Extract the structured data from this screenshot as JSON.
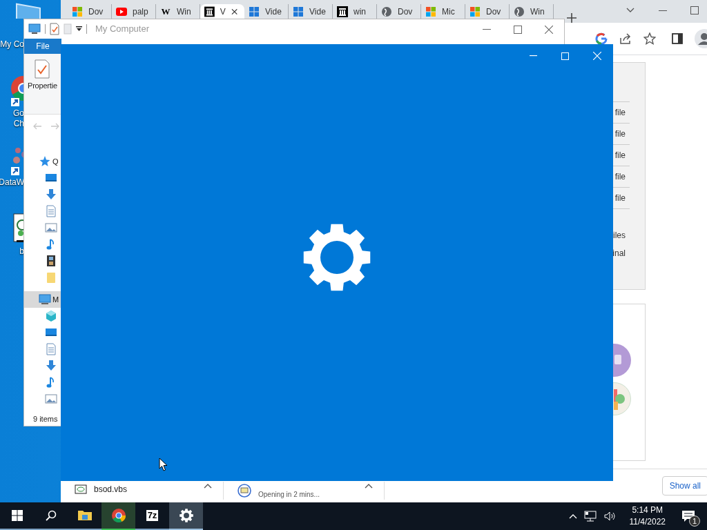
{
  "desktop_icons": [
    {
      "kind": "computer",
      "lines": [
        "My Co"
      ]
    },
    {
      "kind": "chrome",
      "shortcut": true,
      "lines": [
        "Go",
        "Ch"
      ]
    },
    {
      "kind": "data",
      "shortcut": true,
      "lines": [
        "DataW"
      ]
    },
    {
      "kind": "script",
      "shortcut": false,
      "lines": [
        "b"
      ]
    }
  ],
  "browser": {
    "tabs": [
      {
        "kind": "ms",
        "label": "Dov",
        "selected": false
      },
      {
        "kind": "video",
        "label": "palp",
        "selected": false
      },
      {
        "kind": "wiki",
        "favicon_text": "W",
        "label": "Win",
        "selected": false
      },
      {
        "kind": "archive",
        "label": "V",
        "selected": true
      },
      {
        "kind": "win",
        "label": "Vide",
        "selected": false
      },
      {
        "kind": "win",
        "label": "Vide",
        "selected": false
      },
      {
        "kind": "archive",
        "label": "win",
        "selected": false
      },
      {
        "kind": "globe",
        "label": "Dov",
        "selected": false
      },
      {
        "kind": "ms",
        "label": "Mic",
        "selected": false
      },
      {
        "kind": "ms",
        "label": "Dov",
        "selected": false
      },
      {
        "kind": "globe",
        "label": "Win",
        "selected": false
      }
    ],
    "card_sections": [
      {
        "kind": "list",
        "rows": [
          "file",
          "file",
          "file",
          "file",
          "file"
        ]
      },
      {
        "kind": "plain",
        "rows": [
          "iles",
          "inal"
        ]
      }
    ],
    "downloads": [
      {
        "kind": "file",
        "text": "bsod.vbs"
      },
      {
        "kind": "pending",
        "text": "Opening in 2 mins..."
      }
    ],
    "show_all": "Show all"
  },
  "explorer": {
    "title": "My Computer",
    "ribbon_tab": "File",
    "ribbon_command": "Propertie",
    "nav": [
      {
        "kind": "star",
        "label": "Q",
        "selected": false,
        "children": [
          {
            "kind": "desktop",
            "selected": false
          },
          {
            "kind": "download",
            "selected": false
          },
          {
            "kind": "document",
            "selected": false
          },
          {
            "kind": "pictures",
            "selected": false
          },
          {
            "kind": "music",
            "selected": false
          },
          {
            "kind": "video",
            "selected": false
          },
          {
            "kind": "folder",
            "selected": false
          }
        ]
      },
      {
        "kind": "computer",
        "label": "M",
        "selected": true,
        "children": [
          {
            "kind": "cube",
            "selected": false
          },
          {
            "kind": "desktop",
            "selected": false
          },
          {
            "kind": "document",
            "selected": false
          },
          {
            "kind": "download",
            "selected": false
          },
          {
            "kind": "music",
            "selected": false
          },
          {
            "kind": "pictures",
            "selected": false
          }
        ]
      }
    ],
    "status": "9 items"
  },
  "taskbar": {
    "apps": [
      {
        "kind": "explorer",
        "active": false,
        "flashing": false
      },
      {
        "kind": "chrome",
        "active": false,
        "flashing": true
      },
      {
        "kind": "sevenzip",
        "label": "7z",
        "active": false,
        "flashing": false
      },
      {
        "kind": "settings",
        "active": true,
        "flashing": false
      }
    ],
    "time": "5:14 PM",
    "date": "11/4/2022",
    "notifications": "1"
  }
}
